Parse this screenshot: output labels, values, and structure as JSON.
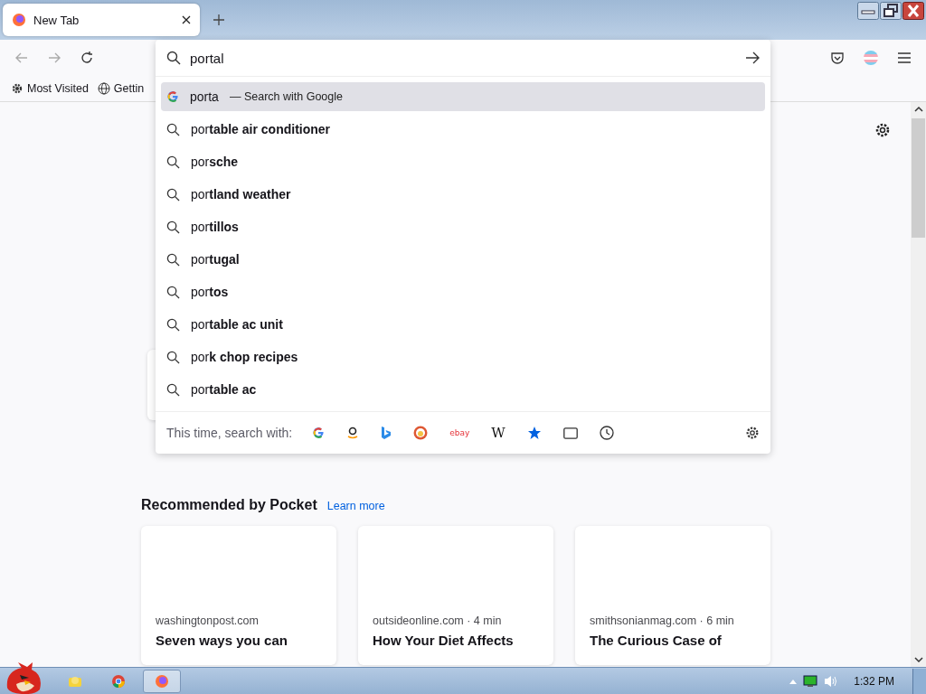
{
  "tabs": [
    {
      "title": "New Tab",
      "selected": true
    }
  ],
  "bookmarks": [
    {
      "label": "Most Visited",
      "kind": "gear"
    },
    {
      "label": "Gettin",
      "kind": "globe"
    }
  ],
  "urlbar": {
    "value": "portal"
  },
  "suggestions": [
    {
      "kind": "engine",
      "text": "porta",
      "hint": "— Search with Google",
      "selected": true
    },
    {
      "kind": "search",
      "text": "por**table air conditioner**",
      "selected": false
    },
    {
      "kind": "search",
      "text": "por**sche**",
      "selected": false
    },
    {
      "kind": "search",
      "text": "por**tland weather**",
      "selected": false
    },
    {
      "kind": "search",
      "text": "por**tillos**",
      "selected": false
    },
    {
      "kind": "search",
      "text": "por**tugal**",
      "selected": false
    },
    {
      "kind": "search",
      "text": "por**tos**",
      "selected": false
    },
    {
      "kind": "search",
      "text": "por**table ac unit**",
      "selected": false
    },
    {
      "kind": "search",
      "text": "por**k chop recipes**",
      "selected": false
    },
    {
      "kind": "search",
      "text": "por**table ac**",
      "selected": false
    }
  ],
  "one_offs": {
    "label": "This time, search with:",
    "engines": [
      {
        "kind": "google"
      },
      {
        "kind": "amazon"
      },
      {
        "kind": "bing"
      },
      {
        "kind": "duckduckgo"
      },
      {
        "kind": "ebay",
        "glyph": "ebay"
      },
      {
        "kind": "wikipedia",
        "glyph": "W"
      },
      {
        "kind": "bookmarks"
      },
      {
        "kind": "tabs"
      },
      {
        "kind": "history"
      }
    ]
  },
  "pocket": {
    "title": "Recommended by Pocket",
    "link": "Learn more",
    "cards": [
      {
        "source": "washingtonpost.com",
        "title": "Seven ways you can"
      },
      {
        "source": "outsideonline.com · 4 min",
        "title": "How Your Diet Affects"
      },
      {
        "source": "smithsonianmag.com · 6 min",
        "title": "The Curious Case of"
      }
    ]
  },
  "taskbar": {
    "apps": [
      {
        "kind": "folder",
        "selected": false
      },
      {
        "kind": "chrome",
        "selected": false
      },
      {
        "kind": "firefox",
        "selected": true
      }
    ],
    "clock": "1:32 PM"
  }
}
